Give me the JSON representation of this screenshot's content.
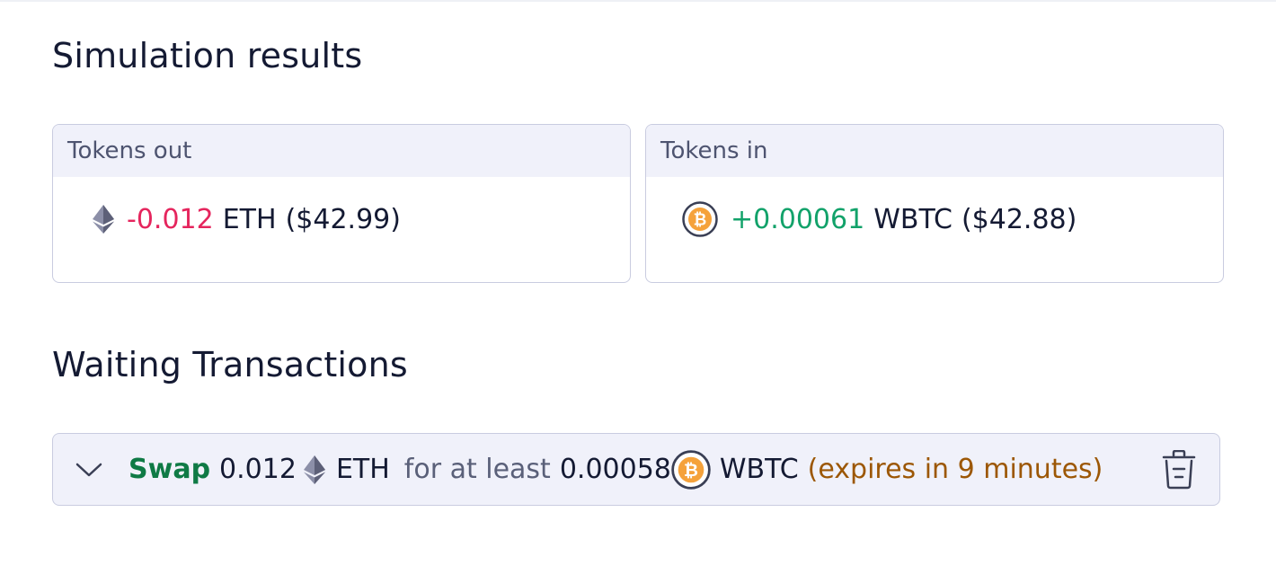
{
  "simulation": {
    "title": "Simulation results",
    "tokens_out": {
      "header": "Tokens out",
      "icon": "eth-icon",
      "amount": "-0.012",
      "symbol": "ETH",
      "usd": "($42.99)"
    },
    "tokens_in": {
      "header": "Tokens in",
      "icon": "wbtc-icon",
      "amount": "+0.00061",
      "symbol": "WBTC",
      "usd": "($42.88)"
    }
  },
  "waiting": {
    "title": "Waiting Transactions",
    "transaction": {
      "action": "Swap",
      "amount_in": "0.012",
      "symbol_in": "ETH",
      "connector": "for at least",
      "amount_out": "0.00058",
      "symbol_out": "WBTC",
      "expiry": "(expires in 9 minutes)"
    }
  },
  "colors": {
    "negative": "#e5255d",
    "positive": "#12a26a",
    "swap": "#0f7a45",
    "expiry": "#9c5705",
    "border": "#c9cce0",
    "header_bg": "#f0f1fa"
  }
}
